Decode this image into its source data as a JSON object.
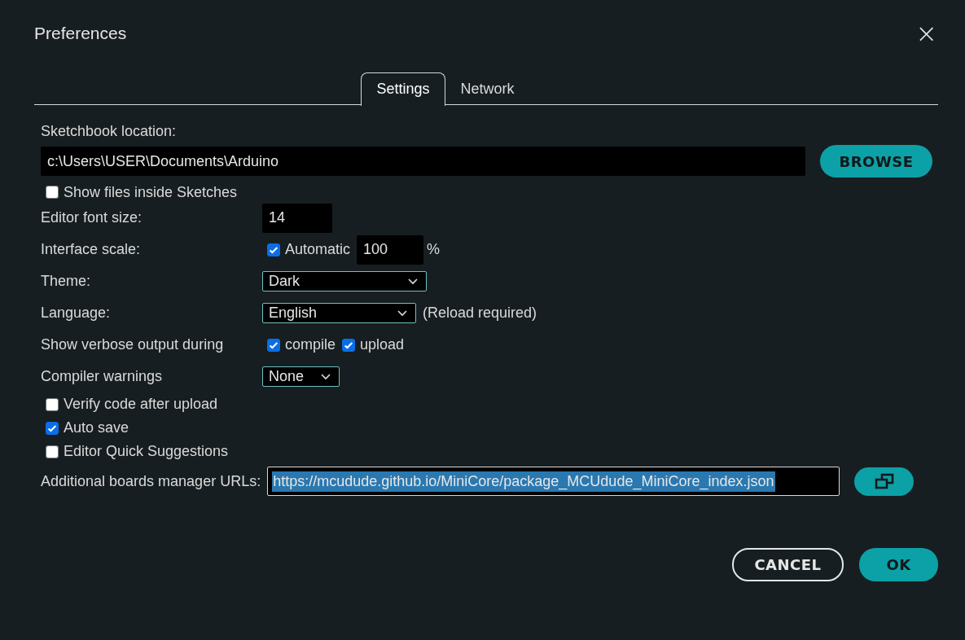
{
  "window": {
    "title": "Preferences",
    "close_glyph": "×"
  },
  "tabs": [
    {
      "label": "Settings",
      "selected": true
    },
    {
      "label": "Network",
      "selected": false
    }
  ],
  "sketchbook": {
    "label": "Sketchbook location:",
    "value": "c:\\Users\\USER\\Documents\\Arduino",
    "button": "BROWSE"
  },
  "show_files": {
    "label": "Show files inside Sketches",
    "checked": false
  },
  "editor_font_size": {
    "label": "Editor font size:",
    "value": "14"
  },
  "interface_scale": {
    "label": "Interface scale:",
    "automatic": {
      "label": "Automatic",
      "checked": true
    },
    "value": "100",
    "unit": "%"
  },
  "theme": {
    "label": "Theme:",
    "value": "Dark"
  },
  "language": {
    "label": "Language:",
    "value": "English",
    "note": "(Reload required)"
  },
  "verbose": {
    "label": "Show verbose output during",
    "options": [
      {
        "label": "compile",
        "checked": true
      },
      {
        "label": "upload",
        "checked": true
      }
    ]
  },
  "compiler_warnings": {
    "label": "Compiler warnings",
    "value": "None"
  },
  "options": [
    {
      "label": "Verify code after upload",
      "checked": false
    },
    {
      "label": "Auto save",
      "checked": true
    },
    {
      "label": "Editor Quick Suggestions",
      "checked": false
    }
  ],
  "boards_urls": {
    "label": "Additional boards manager URLs:",
    "value": "https://mcudude.github.io/MiniCore/package_MCUdude_MiniCore_index.json",
    "text_selected": true
  },
  "buttons": [
    {
      "label": "CANCEL",
      "kind": "secondary"
    },
    {
      "label": "OK",
      "kind": "primary"
    }
  ]
}
